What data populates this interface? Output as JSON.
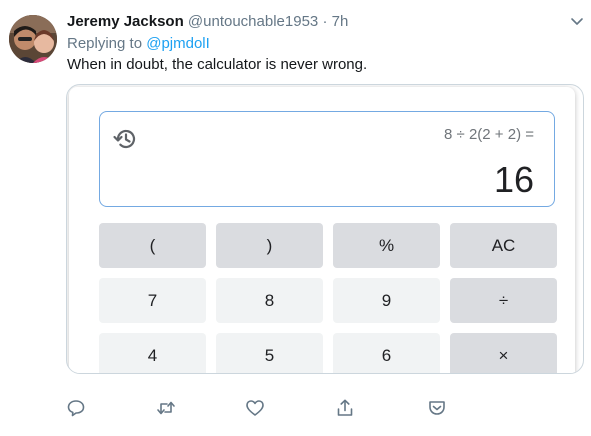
{
  "tweet": {
    "author_name": "Jeremy Jackson",
    "handle": "@untouchable1953",
    "separator": "·",
    "time": "7h",
    "replying_prefix": "Replying to",
    "replying_mention": "@pjmdolI",
    "text": "When in doubt, the calculator is never wrong."
  },
  "calculator": {
    "expression": "8 ÷ 2(2 + 2) =",
    "result": "16",
    "keys": [
      {
        "label": "(",
        "type": "op",
        "name": "key-open-paren"
      },
      {
        "label": ")",
        "type": "op",
        "name": "key-close-paren"
      },
      {
        "label": "%",
        "type": "op",
        "name": "key-percent"
      },
      {
        "label": "AC",
        "type": "op",
        "name": "key-all-clear"
      },
      {
        "label": "7",
        "type": "num",
        "name": "key-7"
      },
      {
        "label": "8",
        "type": "num",
        "name": "key-8"
      },
      {
        "label": "9",
        "type": "num",
        "name": "key-9"
      },
      {
        "label": "÷",
        "type": "op",
        "name": "key-divide"
      },
      {
        "label": "4",
        "type": "num",
        "name": "key-4"
      },
      {
        "label": "5",
        "type": "num",
        "name": "key-5"
      },
      {
        "label": "6",
        "type": "num",
        "name": "key-6"
      },
      {
        "label": "×",
        "type": "op",
        "name": "key-multiply"
      }
    ]
  },
  "icons": {
    "menu": "chevron-down-icon",
    "history": "history-icon",
    "reply": "reply-icon",
    "retweet": "retweet-icon",
    "like": "like-icon",
    "share": "share-icon",
    "pocket": "pocket-icon"
  },
  "colors": {
    "link": "#1da1f2",
    "secondary_text": "#657786",
    "display_border": "#74a9e2",
    "key_light": "#f1f3f4",
    "key_dark": "#dadce0"
  }
}
